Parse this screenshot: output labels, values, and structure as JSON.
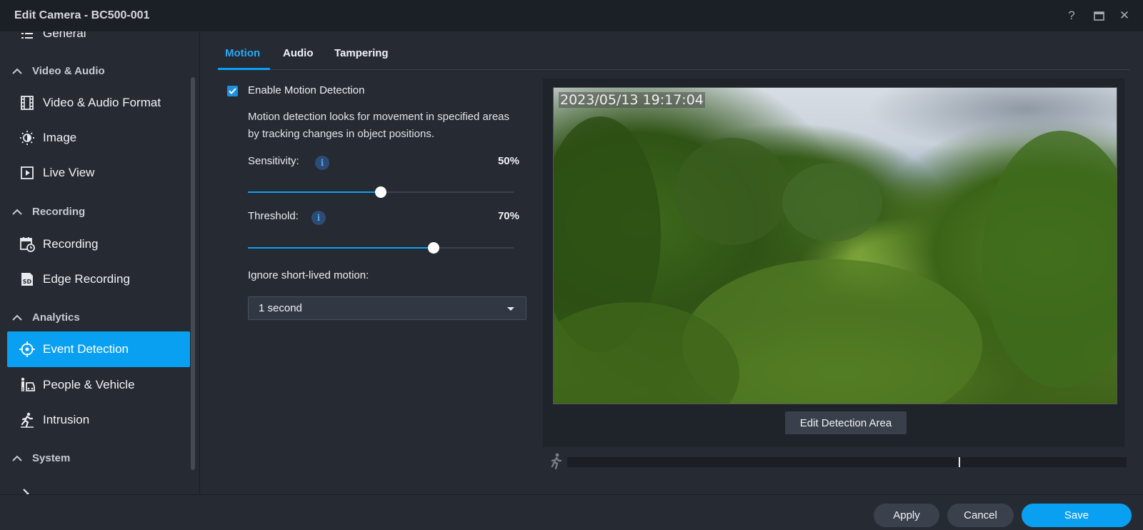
{
  "window": {
    "title": "Edit Camera - BC500-001",
    "help_glyph": "?",
    "close_glyph": "✕"
  },
  "sidebar": {
    "top_partial_item": "General",
    "sections": [
      {
        "label": "Video & Audio"
      },
      {
        "label": "Recording"
      },
      {
        "label": "Analytics"
      },
      {
        "label": "System"
      }
    ],
    "items": [
      {
        "label": "Video & Audio Format",
        "icon": "film-icon"
      },
      {
        "label": "Image",
        "icon": "brightness-icon"
      },
      {
        "label": "Live View",
        "icon": "play-box-icon"
      },
      {
        "label": "Recording",
        "icon": "calendar-clock-icon"
      },
      {
        "label": "Edge Recording",
        "icon": "sd-card-icon"
      },
      {
        "label": "Event Detection",
        "icon": "crosshair-icon",
        "active": true
      },
      {
        "label": "People & Vehicle",
        "icon": "person-vehicle-icon"
      },
      {
        "label": "Intrusion",
        "icon": "running-person-icon"
      }
    ]
  },
  "tabs": [
    {
      "label": "Motion",
      "active": true
    },
    {
      "label": "Audio"
    },
    {
      "label": "Tampering"
    }
  ],
  "motion": {
    "enable_label": "Enable Motion Detection",
    "enabled": true,
    "description": "Motion detection looks for movement in specified areas by tracking changes in object positions.",
    "sensitivity_label": "Sensitivity:",
    "sensitivity_value": "50%",
    "sensitivity_fraction": 0.5,
    "threshold_label": "Threshold:",
    "threshold_value": "70%",
    "threshold_fraction": 0.7,
    "info_glyph": "i",
    "ignore_label": "Ignore short-lived motion:",
    "ignore_value": "1 second"
  },
  "preview": {
    "timestamp": "2023/05/13 19:17:04",
    "edit_button": "Edit Detection Area",
    "timeline_marker_fraction": 0.7
  },
  "footer": {
    "apply": "Apply",
    "cancel": "Cancel",
    "save": "Save"
  },
  "colors": {
    "accent": "#0aa0f2",
    "background": "#252a33",
    "titlebar": "#1b1f26"
  }
}
